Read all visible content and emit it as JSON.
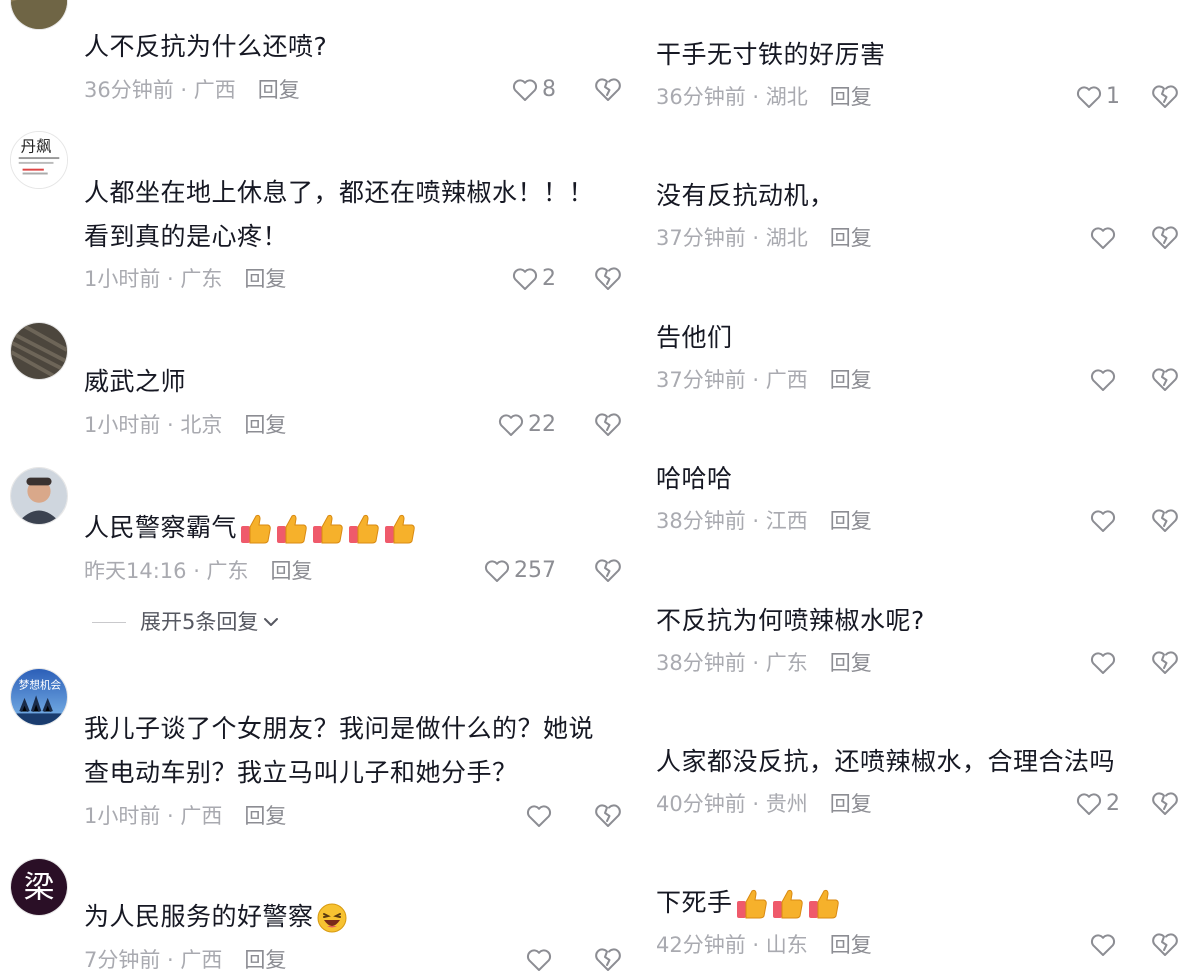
{
  "left_column": [
    {
      "text_lines": [
        "人不反抗为什么还喷?"
      ],
      "time_location": "36分钟前 · 广西",
      "reply_label": "回复",
      "likes": "8",
      "emoji_count": 0
    },
    {
      "text_lines": [
        "人都坐在地上休息了，都还在喷辣椒水！！！",
        "看到真的是心疼！"
      ],
      "time_location": "1小时前 · 广东",
      "reply_label": "回复",
      "likes": "2",
      "emoji_count": 0
    },
    {
      "text_lines": [
        "威武之师"
      ],
      "time_location": "1小时前 · 北京",
      "reply_label": "回复",
      "likes": "22",
      "emoji_count": 0
    },
    {
      "text_lines": [
        "人民警察霸气"
      ],
      "time_location": "昨天14:16 · 广东",
      "reply_label": "回复",
      "likes": "257",
      "emoji": "thumbs-up",
      "emoji_count": 5
    },
    {
      "text_lines": [
        "我儿子谈了个女朋友？我问是做什么的？她说",
        "查电动车别？我立马叫儿子和她分手？"
      ],
      "time_location": "1小时前 · 广西",
      "reply_label": "回复",
      "likes": "",
      "emoji_count": 0
    },
    {
      "text_lines": [
        "为人民服务的好警察"
      ],
      "time_location": "7分钟前 · 广西",
      "reply_label": "回复",
      "likes": "",
      "emoji": "laughing-face",
      "emoji_count": 1
    }
  ],
  "expand_replies_label": "展开5条回复",
  "right_column": [
    {
      "text_lines": [
        "干手无寸铁的好厉害"
      ],
      "time_location": "36分钟前 · 湖北",
      "reply_label": "回复",
      "likes": "1"
    },
    {
      "text_lines": [
        "没有反抗动机，"
      ],
      "time_location": "37分钟前 · 湖北",
      "reply_label": "回复",
      "likes": ""
    },
    {
      "text_lines": [
        "告他们"
      ],
      "time_location": "37分钟前 · 广西",
      "reply_label": "回复",
      "likes": ""
    },
    {
      "text_lines": [
        "哈哈哈"
      ],
      "time_location": "38分钟前 · 江西",
      "reply_label": "回复",
      "likes": ""
    },
    {
      "text_lines": [
        "不反抗为何喷辣椒水呢?"
      ],
      "time_location": "38分钟前 · 广东",
      "reply_label": "回复",
      "likes": ""
    },
    {
      "text_lines": [
        "人家都没反抗，还喷辣椒水，合理合法吗"
      ],
      "time_location": "40分钟前 · 贵州",
      "reply_label": "回复",
      "likes": "2"
    },
    {
      "text_lines": [
        "下死手"
      ],
      "time_location": "42分钟前 · 山东",
      "reply_label": "回复",
      "likes": "",
      "emoji": "thumbs-up",
      "emoji_count": 3
    }
  ],
  "avatar_texts": {
    "avatar_5": "梦想机会",
    "avatar_6": "梁"
  },
  "icons": {
    "like": "heart-outline-icon",
    "dislike": "broken-heart-icon",
    "expand": "chevron-down-icon"
  },
  "colors": {
    "text": "#161823",
    "meta": "#a9aab0",
    "icon": "#8c8d93",
    "thumb": "#f6b12b",
    "cuff": "#ef5a6b"
  }
}
